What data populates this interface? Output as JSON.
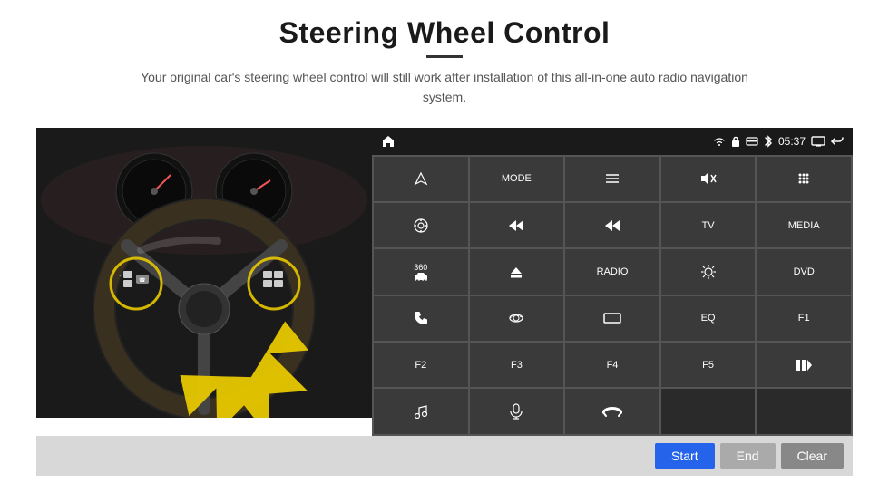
{
  "header": {
    "title": "Steering Wheel Control",
    "divider": true,
    "subtitle": "Your original car's steering wheel control will still work after installation of this all-in-one auto radio navigation system."
  },
  "status_bar": {
    "time": "05:37",
    "icons": [
      "wifi",
      "lock",
      "card",
      "bluetooth",
      "display",
      "back"
    ]
  },
  "grid": {
    "rows": [
      [
        {
          "type": "icon",
          "icon": "navigate",
          "label": ""
        },
        {
          "type": "text",
          "label": "MODE"
        },
        {
          "type": "icon",
          "icon": "list",
          "label": ""
        },
        {
          "type": "icon",
          "icon": "mute",
          "label": ""
        },
        {
          "type": "icon",
          "icon": "dots-grid",
          "label": ""
        }
      ],
      [
        {
          "type": "icon",
          "icon": "settings-circle",
          "label": ""
        },
        {
          "type": "icon",
          "icon": "rewind",
          "label": ""
        },
        {
          "type": "icon",
          "icon": "fast-forward",
          "label": ""
        },
        {
          "type": "text",
          "label": "TV"
        },
        {
          "type": "text",
          "label": "MEDIA"
        }
      ],
      [
        {
          "type": "icon",
          "icon": "360-car",
          "label": ""
        },
        {
          "type": "icon",
          "icon": "eject",
          "label": ""
        },
        {
          "type": "text",
          "label": "RADIO"
        },
        {
          "type": "icon",
          "icon": "brightness",
          "label": ""
        },
        {
          "type": "text",
          "label": "DVD"
        }
      ],
      [
        {
          "type": "icon",
          "icon": "phone",
          "label": ""
        },
        {
          "type": "icon",
          "icon": "orbit",
          "label": ""
        },
        {
          "type": "icon",
          "icon": "rectangle",
          "label": ""
        },
        {
          "type": "text",
          "label": "EQ"
        },
        {
          "type": "text",
          "label": "F1"
        }
      ],
      [
        {
          "type": "text",
          "label": "F2"
        },
        {
          "type": "text",
          "label": "F3"
        },
        {
          "type": "text",
          "label": "F4"
        },
        {
          "type": "text",
          "label": "F5"
        },
        {
          "type": "icon",
          "icon": "play-pause",
          "label": ""
        }
      ],
      [
        {
          "type": "icon",
          "icon": "music-note",
          "label": ""
        },
        {
          "type": "icon",
          "icon": "microphone",
          "label": ""
        },
        {
          "type": "icon",
          "icon": "phone-end",
          "label": ""
        },
        {
          "type": "empty",
          "label": ""
        },
        {
          "type": "empty",
          "label": ""
        }
      ]
    ]
  },
  "bottom_bar": {
    "start_label": "Start",
    "end_label": "End",
    "clear_label": "Clear"
  }
}
